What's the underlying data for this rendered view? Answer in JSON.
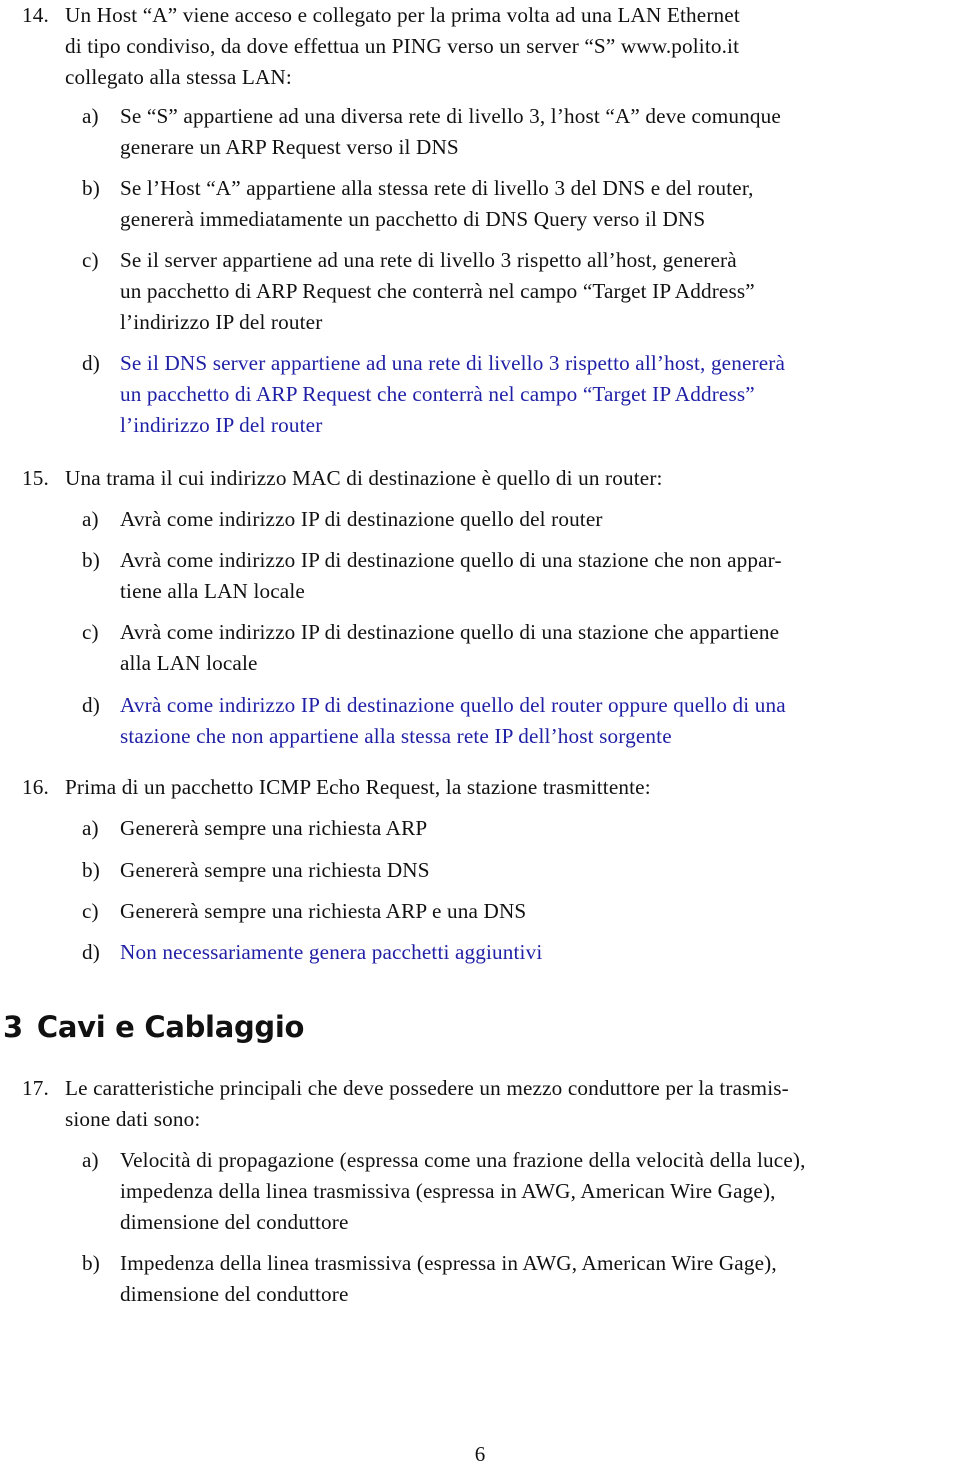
{
  "colors": {
    "text": "#111111",
    "correct_answer": "#1f1fa6",
    "background": "#ffffff"
  },
  "questions": [
    {
      "number": "14.",
      "lines": [
        "Un Host “A” viene acceso e collegato per la prima volta ad una LAN Ethernet",
        "di tipo condiviso, da dove effettua un PING verso un server “S” www.polito.it",
        "collegato alla stessa LAN:"
      ],
      "options": [
        {
          "label": "a)",
          "correct": false,
          "lines": [
            "Se “S” appartiene ad una diversa rete di livello 3, l’host “A” deve comunque",
            "generare un ARP Request verso il DNS"
          ]
        },
        {
          "label": "b)",
          "correct": false,
          "lines": [
            "Se l’Host “A” appartiene alla stessa rete di livello 3 del DNS e del router,",
            "genererà immediatamente un pacchetto di DNS Query verso il DNS"
          ]
        },
        {
          "label": "c)",
          "correct": false,
          "lines": [
            "Se il server appartiene ad una rete di livello 3 rispetto all’host, genererà",
            "un pacchetto di ARP Request che conterrà nel campo “Target IP Address”",
            "l’indirizzo IP del router"
          ]
        },
        {
          "label": "d)",
          "correct": true,
          "lines": [
            "Se il DNS server appartiene ad una rete di livello 3 rispetto all’host, genererà",
            "un pacchetto di ARP Request che conterrà nel campo “Target IP Address”",
            "l’indirizzo IP del router"
          ]
        }
      ]
    },
    {
      "number": "15.",
      "lines": [
        "Una trama il cui indirizzo MAC di destinazione è quello di un router:"
      ],
      "options": [
        {
          "label": "a)",
          "correct": false,
          "lines": [
            "Avrà come indirizzo IP di destinazione quello del router"
          ]
        },
        {
          "label": "b)",
          "correct": false,
          "lines": [
            "Avrà come indirizzo IP di destinazione quello di una stazione che non appar-",
            "tiene alla LAN locale"
          ]
        },
        {
          "label": "c)",
          "correct": false,
          "lines": [
            "Avrà come indirizzo IP di destinazione quello di una stazione che appartiene",
            "alla LAN locale"
          ]
        },
        {
          "label": "d)",
          "correct": true,
          "lines": [
            "Avrà come indirizzo IP di destinazione quello del router oppure quello di una",
            "stazione che non appartiene alla stessa rete IP dell’host sorgente"
          ]
        }
      ]
    },
    {
      "number": "16.",
      "lines": [
        "Prima di un pacchetto ICMP Echo Request, la stazione trasmittente:"
      ],
      "options": [
        {
          "label": "a)",
          "correct": false,
          "lines": [
            "Genererà sempre una richiesta ARP"
          ]
        },
        {
          "label": "b)",
          "correct": false,
          "lines": [
            "Genererà sempre una richiesta DNS"
          ]
        },
        {
          "label": "c)",
          "correct": false,
          "lines": [
            "Genererà sempre una richiesta ARP e una DNS"
          ]
        },
        {
          "label": "d)",
          "correct": true,
          "lines": [
            "Non necessariamente genera pacchetti aggiuntivi"
          ]
        }
      ]
    },
    {
      "number": "17.",
      "lines": [
        "Le caratteristiche principali che deve possedere un mezzo conduttore per la trasmis-",
        "sione dati sono:"
      ],
      "options": [
        {
          "label": "a)",
          "correct": false,
          "lines": [
            "Velocità di propagazione (espressa come una frazione della velocità della luce),",
            "impedenza della linea trasmissiva (espressa in AWG, American Wire Gage),",
            "dimensione del conduttore"
          ]
        },
        {
          "label": "b)",
          "correct": false,
          "lines": [
            "Impedenza della linea trasmissiva (espressa in AWG, American Wire Gage),",
            "dimensione del conduttore"
          ]
        }
      ]
    }
  ],
  "section": {
    "number": "3",
    "title": "Cavi e Cablaggio"
  },
  "page_number": "6"
}
